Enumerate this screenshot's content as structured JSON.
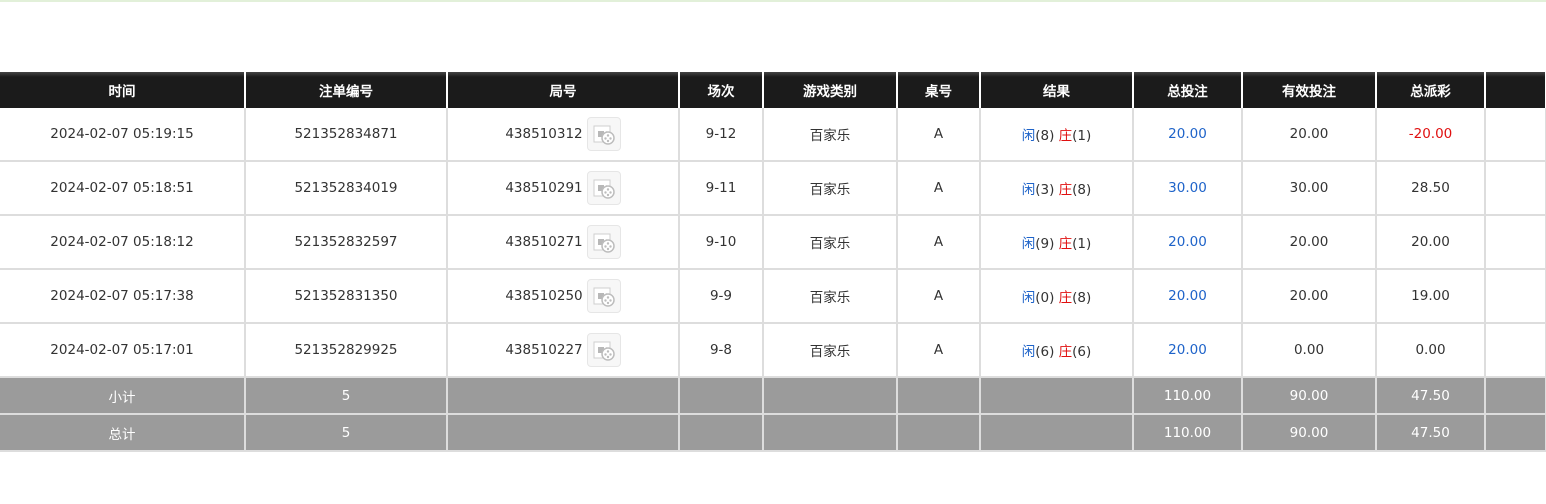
{
  "colors": {
    "player": "#1e63c9",
    "banker": "#e01010",
    "bet_total": "#1e63c9",
    "negative_payout": "#e01010"
  },
  "table": {
    "headers": [
      "时间",
      "注单编号",
      "局号",
      "场次",
      "游戏类别",
      "桌号",
      "结果",
      "总投注",
      "有效投注",
      "总派彩",
      ""
    ],
    "rows": [
      {
        "time": "2024-02-07 05:19:15",
        "bet_id": "521352834871",
        "round_id": "438510312",
        "shoe": "9-12",
        "game": "百家乐",
        "table": "A",
        "player_label": "闲",
        "player_score": "(8)",
        "banker_label": "庄",
        "banker_score": "(1)",
        "total_bet": "20.00",
        "valid_bet": "20.00",
        "payout": "-20.00",
        "payout_negative": true
      },
      {
        "time": "2024-02-07 05:18:51",
        "bet_id": "521352834019",
        "round_id": "438510291",
        "shoe": "9-11",
        "game": "百家乐",
        "table": "A",
        "player_label": "闲",
        "player_score": "(3)",
        "banker_label": "庄",
        "banker_score": "(8)",
        "total_bet": "30.00",
        "valid_bet": "30.00",
        "payout": "28.50",
        "payout_negative": false
      },
      {
        "time": "2024-02-07 05:18:12",
        "bet_id": "521352832597",
        "round_id": "438510271",
        "shoe": "9-10",
        "game": "百家乐",
        "table": "A",
        "player_label": "闲",
        "player_score": "(9)",
        "banker_label": "庄",
        "banker_score": "(1)",
        "total_bet": "20.00",
        "valid_bet": "20.00",
        "payout": "20.00",
        "payout_negative": false
      },
      {
        "time": "2024-02-07 05:17:38",
        "bet_id": "521352831350",
        "round_id": "438510250",
        "shoe": "9-9",
        "game": "百家乐",
        "table": "A",
        "player_label": "闲",
        "player_score": "(0)",
        "banker_label": "庄",
        "banker_score": "(8)",
        "total_bet": "20.00",
        "valid_bet": "20.00",
        "payout": "19.00",
        "payout_negative": false
      },
      {
        "time": "2024-02-07 05:17:01",
        "bet_id": "521352829925",
        "round_id": "438510227",
        "shoe": "9-8",
        "game": "百家乐",
        "table": "A",
        "player_label": "闲",
        "player_score": "(6)",
        "banker_label": "庄",
        "banker_score": "(6)",
        "total_bet": "20.00",
        "valid_bet": "0.00",
        "payout": "0.00",
        "payout_negative": false
      }
    ],
    "subtotal": {
      "label": "小计",
      "count": "5",
      "total_bet": "110.00",
      "valid_bet": "90.00",
      "payout": "47.50"
    },
    "grand_total": {
      "label": "总计",
      "count": "5",
      "total_bet": "110.00",
      "valid_bet": "90.00",
      "payout": "47.50"
    }
  }
}
